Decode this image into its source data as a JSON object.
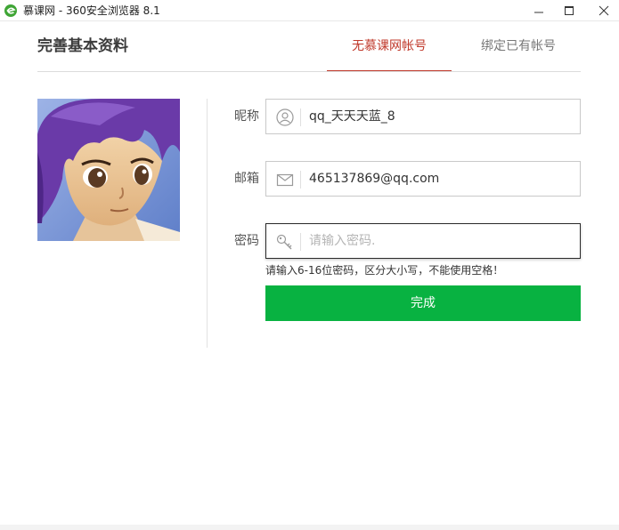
{
  "window": {
    "title": "慕课网 - 360安全浏览器 8.1",
    "app_icon": "360-browser-icon",
    "controls": [
      "minimize-icon",
      "maximize-icon",
      "close-icon"
    ]
  },
  "header": {
    "title": "完善基本资料",
    "tabs": [
      {
        "label": "无慕课网帐号",
        "active": true
      },
      {
        "label": "绑定已有帐号",
        "active": false
      }
    ],
    "accent_color": "#c0392b"
  },
  "avatar": {
    "description_icon": "user-avatar-image"
  },
  "form": {
    "nickname": {
      "label": "昵称",
      "value": "qq_天天天蓝_8",
      "icon": "user-icon"
    },
    "email": {
      "label": "邮箱",
      "value": "465137869@qq.com",
      "icon": "mail-icon"
    },
    "password": {
      "label": "密码",
      "value": "",
      "placeholder": "请输入密码.",
      "icon": "key-icon"
    },
    "hint": "请输入6-16位密码，区分大小写，不能使用空格！",
    "submit_label": "完成",
    "submit_color": "#08b241"
  }
}
